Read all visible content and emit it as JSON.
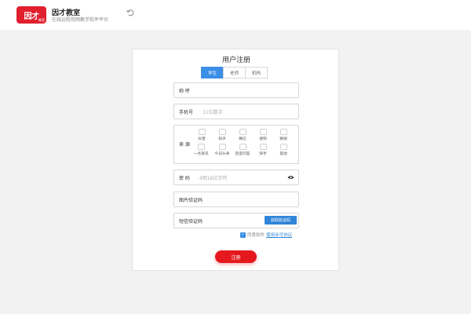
{
  "header": {
    "logo_text": "因才",
    "logo_sub": "教室",
    "brand_title": "因才教室",
    "brand_subtitle": "在线远程视频教学软件平台"
  },
  "form": {
    "title": "用户注册",
    "tabs": [
      {
        "label": "学生",
        "active": true
      },
      {
        "label": "老师",
        "active": false
      },
      {
        "label": "机构",
        "active": false
      }
    ],
    "nickname_label": "称 呼",
    "phone_label": "手机号",
    "phone_placeholder": "11位数字",
    "source_label": "来 源",
    "source_options_row1": [
      "抖音",
      "知乎",
      "微信",
      "搜狗",
      "微视"
    ],
    "source_options_row2": [
      "一点资讯",
      "今日头条",
      "百度问答",
      "快手",
      "其他"
    ],
    "password_label": "密 码",
    "password_placeholder": "4到16位字符",
    "image_code_label": "图片验证码",
    "sms_code_label": "短信验证码",
    "get_code_label": "获取验证码",
    "agree_text": "同意软件",
    "agree_link": "使用许可协议",
    "submit_label": "注册"
  },
  "colors": {
    "accent_blue": "#3a8ee6",
    "submit_red": "#e5181e",
    "logo_red": "#e0202e"
  }
}
